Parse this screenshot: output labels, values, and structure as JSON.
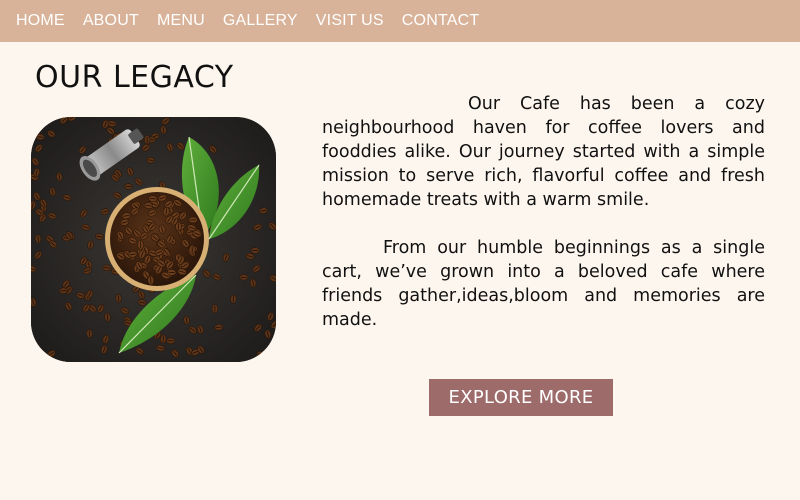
{
  "nav": {
    "items": [
      {
        "label": "HOME"
      },
      {
        "label": "ABOUT"
      },
      {
        "label": "MENU"
      },
      {
        "label": "GALLERY"
      },
      {
        "label": "VISIT US"
      },
      {
        "label": "CONTACT"
      }
    ]
  },
  "legacy": {
    "title": "OUR LEGACY",
    "paragraphs": [
      "Our Cafe has been a cozy neighbourhood haven for coffee lovers and fooddies alike. Our journey started with a simple mission to serve rich, flavorful coffee and fresh homemade treats with a warm smile.",
      "From our humble beginnings as a single cart, we’ve grown into a beloved cafe where friends gather,ideas,bloom and memories are made."
    ],
    "button_label": "EXPLORE MORE"
  },
  "image": {
    "subject": "coffee beans in wooden bowl with green leaves and metal scoop on dark stone"
  },
  "colors": {
    "nav_background": "#d9b399",
    "page_background": "#fdf6ee",
    "button_background": "#9e6b6b",
    "text": "#111111"
  }
}
